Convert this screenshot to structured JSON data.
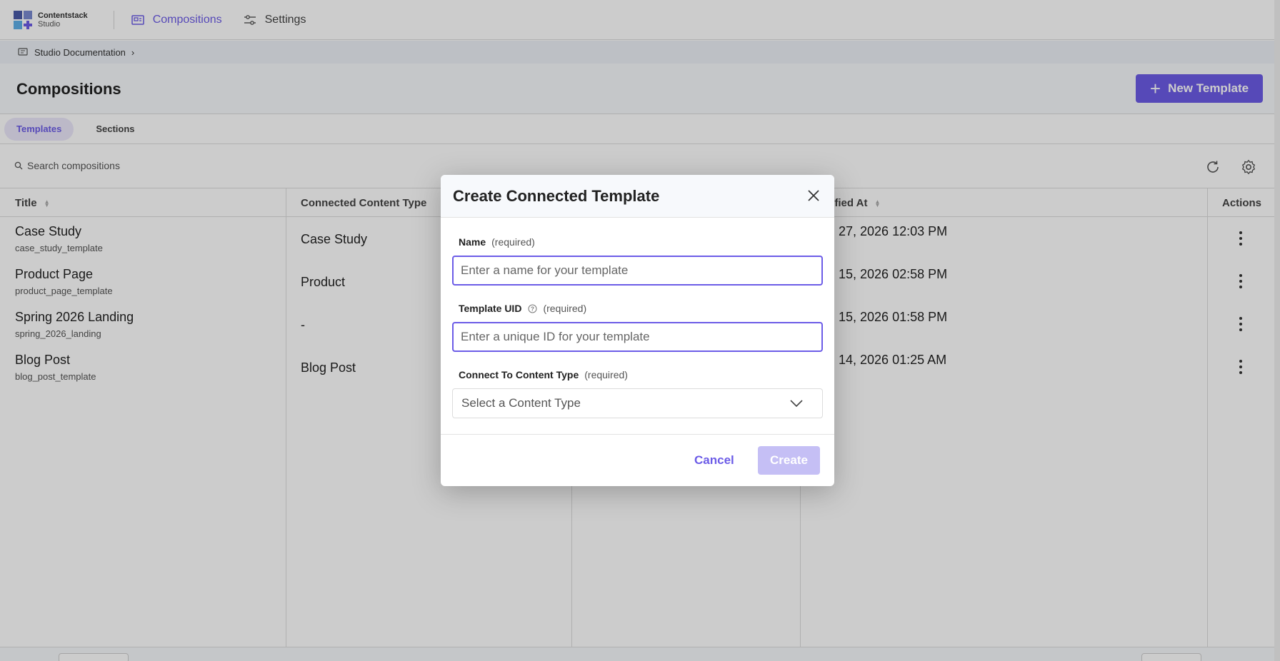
{
  "brand": {
    "name_line1": "Contentstack",
    "name_line2": "Studio",
    "colors": [
      "#4a5ba8",
      "#7a8ad0",
      "#5fb0e8",
      "#6c5ce7"
    ]
  },
  "nav": {
    "items": [
      {
        "label": "Compositions",
        "icon": "compositions-icon",
        "active": true
      },
      {
        "label": "Settings",
        "icon": "sliders-icon",
        "active": false
      }
    ]
  },
  "breadcrumb": {
    "label": "Studio Documentation",
    "icon": "docs-icon"
  },
  "page": {
    "title": "Compositions",
    "new_button_label": "New Template"
  },
  "tabs": [
    {
      "label": "Templates",
      "active": true
    },
    {
      "label": "Sections",
      "active": false
    }
  ],
  "search": {
    "placeholder": "Search compositions"
  },
  "table": {
    "headers": {
      "title": "Title",
      "content_type": "Connected Content Type",
      "modified": "dified At",
      "actions": "Actions"
    },
    "rows": [
      {
        "title": "Case Study",
        "uid": "case_study_template",
        "content_type": "Case Study",
        "modified": "27, 2026 12:03 PM"
      },
      {
        "title": "Product Page",
        "uid": "product_page_template",
        "content_type": "Product",
        "modified": "15, 2026 02:58 PM"
      },
      {
        "title": "Spring 2026 Landing",
        "uid": "spring_2026_landing",
        "content_type": "-",
        "modified": "15, 2026 01:58 PM"
      },
      {
        "title": "Blog Post",
        "uid": "blog_post_template",
        "content_type": "Blog Post",
        "modified": "14, 2026 01:25 AM"
      }
    ]
  },
  "modal": {
    "title": "Create Connected Template",
    "name": {
      "label": "Name",
      "required": "(required)",
      "placeholder": "Enter a name for your template",
      "value": ""
    },
    "uid": {
      "label": "Template UID",
      "required": "(required)",
      "placeholder": "Enter a unique ID for your template",
      "value": ""
    },
    "content_type": {
      "label": "Connect To Content Type",
      "required": "(required)",
      "selected": "Select a Content Type"
    },
    "cancel_label": "Cancel",
    "create_label": "Create"
  },
  "theme": {
    "accent": "#6c5ce7",
    "accent_disabled": "#c5bff5"
  }
}
